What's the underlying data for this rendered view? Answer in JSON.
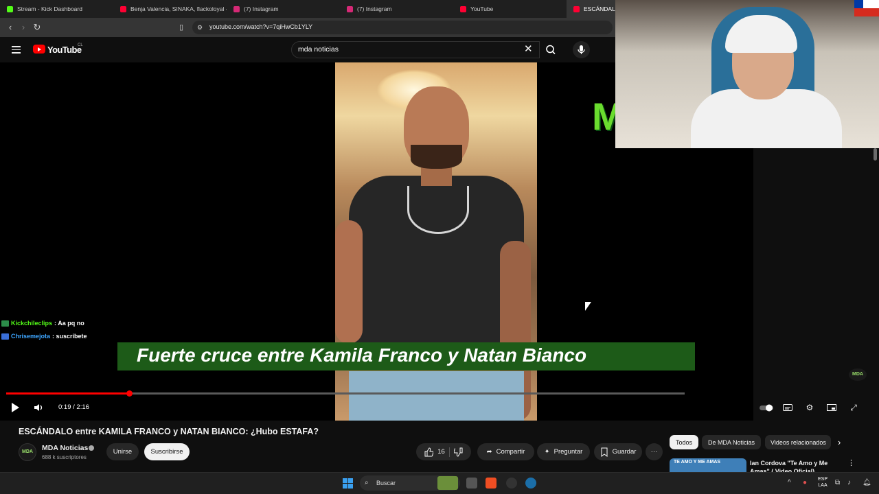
{
  "browser": {
    "tabs": [
      {
        "label": "Stream - Kick Dashboard",
        "favicon_color": "#53fc18"
      },
      {
        "label": "Benja Valencia, SINAKA, flackoloyal -",
        "favicon_color": "#ff0033"
      },
      {
        "label": "(7) Instagram",
        "favicon_color": "#d62976"
      },
      {
        "label": "(7) Instagram",
        "favicon_color": "#d62976"
      },
      {
        "label": "YouTube",
        "favicon_color": "#ff0033"
      },
      {
        "label": "ESCÁNDALO e",
        "favicon_color": "#ff0033"
      }
    ],
    "url": "youtube.com/watch?v=7qiHwCb1YLY"
  },
  "youtube": {
    "logo_text": "YouTube",
    "country_code": "CL",
    "search_value": "mda noticias"
  },
  "video": {
    "caption": "Fuerte cruce entre Kamila Franco y Natan Bianco",
    "watermark": "MDA",
    "overlay_logo": "M",
    "time": "0:19 / 2:16",
    "progress_fraction": 0.181,
    "chat": [
      {
        "user": "Kickchileclips",
        "message": ": Aa pq no",
        "color": "#53fc18"
      },
      {
        "user": "Chrisemejota",
        "message": ": suscribete",
        "color": "#3ea6ff"
      }
    ]
  },
  "details": {
    "title": "ESCÁNDALO entre KAMILA FRANCO y NATAN BIANCO: ¿Hubo ESTAFA?",
    "channel": "MDA Noticias",
    "channel_avatar": "MDA",
    "subscribers": "688 k suscriptores",
    "join_label": "Unirse",
    "subscribe_label": "Suscribirse",
    "likes": "16",
    "share_label": "Compartir",
    "ask_label": "Preguntar",
    "save_label": "Guardar"
  },
  "sidebar": {
    "chips": [
      "Todos",
      "De MDA Noticias",
      "Videos relacionados"
    ],
    "recommendation": {
      "title": "Ian Cordova \"Te Amo y Me Amas\" ( Video Oficial)",
      "thumb_text": "TE AMO Y ME AMAS"
    }
  },
  "taskbar": {
    "search_label": "Buscar",
    "lang_top": "ESP",
    "lang_bottom": "LAA"
  }
}
